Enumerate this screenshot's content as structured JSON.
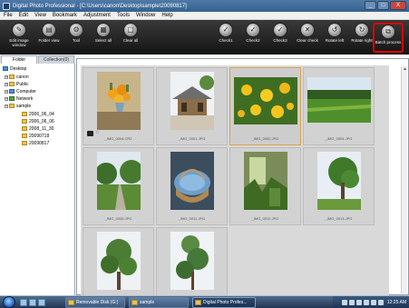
{
  "window": {
    "title": "Digital Photo Professional - [C:\\Users\\canon\\Desktop\\sample\\20090817]",
    "buttons": [
      "_",
      "□",
      "X"
    ]
  },
  "menu": [
    "File",
    "Edit",
    "View",
    "Bookmark",
    "Adjustment",
    "Tools",
    "Window",
    "Help"
  ],
  "toolbar": [
    {
      "label": "Edit image window",
      "icon": "edit-image-icon"
    },
    {
      "label": "Folder view",
      "icon": "folder-view-icon"
    },
    {
      "label": "Tool",
      "icon": "tool-icon"
    },
    {
      "label": "Select all",
      "icon": "select-all-icon"
    },
    {
      "label": "Clear all",
      "icon": "clear-all-icon"
    },
    {
      "label": "Check1",
      "icon": "check1-icon"
    },
    {
      "label": "Check2",
      "icon": "check2-icon"
    },
    {
      "label": "Check3",
      "icon": "check3-icon"
    },
    {
      "label": "Clear check",
      "icon": "clear-check-icon"
    },
    {
      "label": "Rotate left",
      "icon": "rotate-left-icon"
    },
    {
      "label": "Rotate right",
      "icon": "rotate-right-icon"
    },
    {
      "label": "Batch process",
      "icon": "batch-process-icon"
    }
  ],
  "tabs": [
    "Folder",
    "Collection(0)"
  ],
  "tree": [
    {
      "label": "Desktop",
      "icon": "desktop"
    },
    {
      "label": "canon",
      "icon": "folder"
    },
    {
      "label": "Public",
      "icon": "folder"
    },
    {
      "label": "Computer",
      "icon": "computer"
    },
    {
      "label": "Network",
      "icon": "network"
    },
    {
      "label": "sample",
      "icon": "folder"
    },
    {
      "label": "2006_06_04",
      "icon": "folder"
    },
    {
      "label": "2006_06_06",
      "icon": "folder"
    },
    {
      "label": "2008_11_30",
      "icon": "folder"
    },
    {
      "label": "20090718",
      "icon": "folder"
    },
    {
      "label": "20090817",
      "icon": "folder"
    }
  ],
  "thumbnails": [
    {
      "caption": "_IMG_0004.CR2",
      "scene": "flowers in vase",
      "selected": false
    },
    {
      "caption": "_IMG_0001.JPG",
      "scene": "temple building",
      "selected": false
    },
    {
      "caption": "_IMG_0002.JPG",
      "scene": "yellow flowers",
      "selected": true
    },
    {
      "caption": "_IMG_0004.JPG",
      "scene": "green field",
      "selected": false
    },
    {
      "caption": "_IMG_0005.JPG",
      "scene": "country road",
      "selected": false
    },
    {
      "caption": "_IMG_0011.JPG",
      "scene": "basket",
      "selected": false
    },
    {
      "caption": "_IMG_0012.JPG",
      "scene": "garden plants",
      "selected": false
    },
    {
      "caption": "_IMG_0013.JPG",
      "scene": "tree",
      "selected": false
    },
    {
      "caption": "_IMG_0014.JPG",
      "scene": "tree",
      "selected": false
    },
    {
      "caption": "_IMG_0015.JPG",
      "scene": "tree",
      "selected": false
    }
  ],
  "taskbar": {
    "tasks": [
      "Removable Disk (G:)",
      "sample",
      "Digital Photo Profes..."
    ],
    "clock": "12:25 AM"
  }
}
